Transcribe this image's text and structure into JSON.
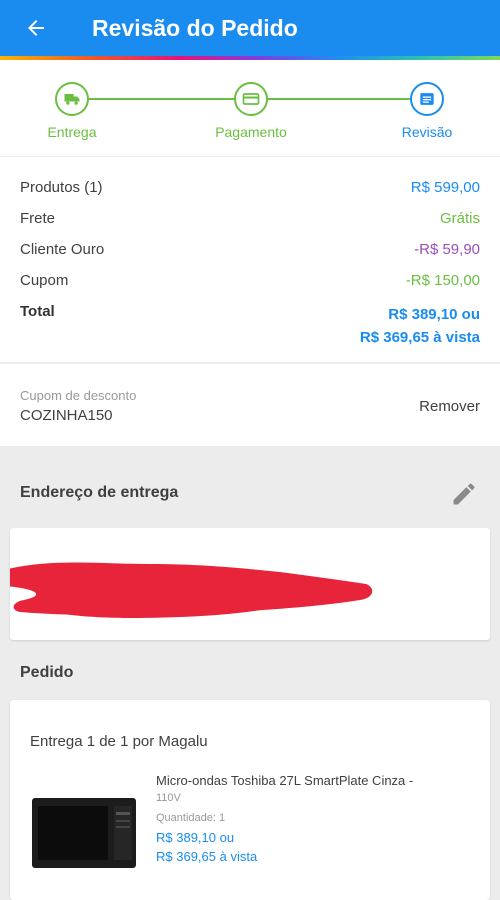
{
  "header": {
    "title": "Revisão do Pedido"
  },
  "stepper": {
    "steps": [
      {
        "label": "Entrega",
        "icon": "truck-icon"
      },
      {
        "label": "Pagamento",
        "icon": "card-icon"
      },
      {
        "label": "Revisão",
        "icon": "list-icon"
      }
    ],
    "active_color": "#1a8cf0",
    "done_color": "#6abf40"
  },
  "summary": {
    "products_label": "Produtos (1)",
    "products_value": "R$ 599,00",
    "shipping_label": "Frete",
    "shipping_value": "Grátis",
    "gold_label": "Cliente Ouro",
    "gold_value": "-R$ 59,90",
    "coupon_label": "Cupom",
    "coupon_value": "-R$ 150,00",
    "total_label": "Total",
    "total_value_1": "R$ 389,10 ou",
    "total_value_2": "R$ 369,65 à vista"
  },
  "coupon": {
    "label": "Cupom de desconto",
    "code": "COZINHA150",
    "remove": "Remover"
  },
  "address": {
    "title": "Endereço de entrega"
  },
  "order": {
    "title": "Pedido",
    "delivery": "Entrega 1 de 1 por Magalu",
    "product_name": "Micro-ondas Toshiba 27L SmartPlate Cinza -",
    "product_voltage": "110V",
    "quantity": "Quantidade:  1",
    "price_1": "R$ 389,10 ou",
    "price_2": "R$ 369,65 à vista"
  }
}
